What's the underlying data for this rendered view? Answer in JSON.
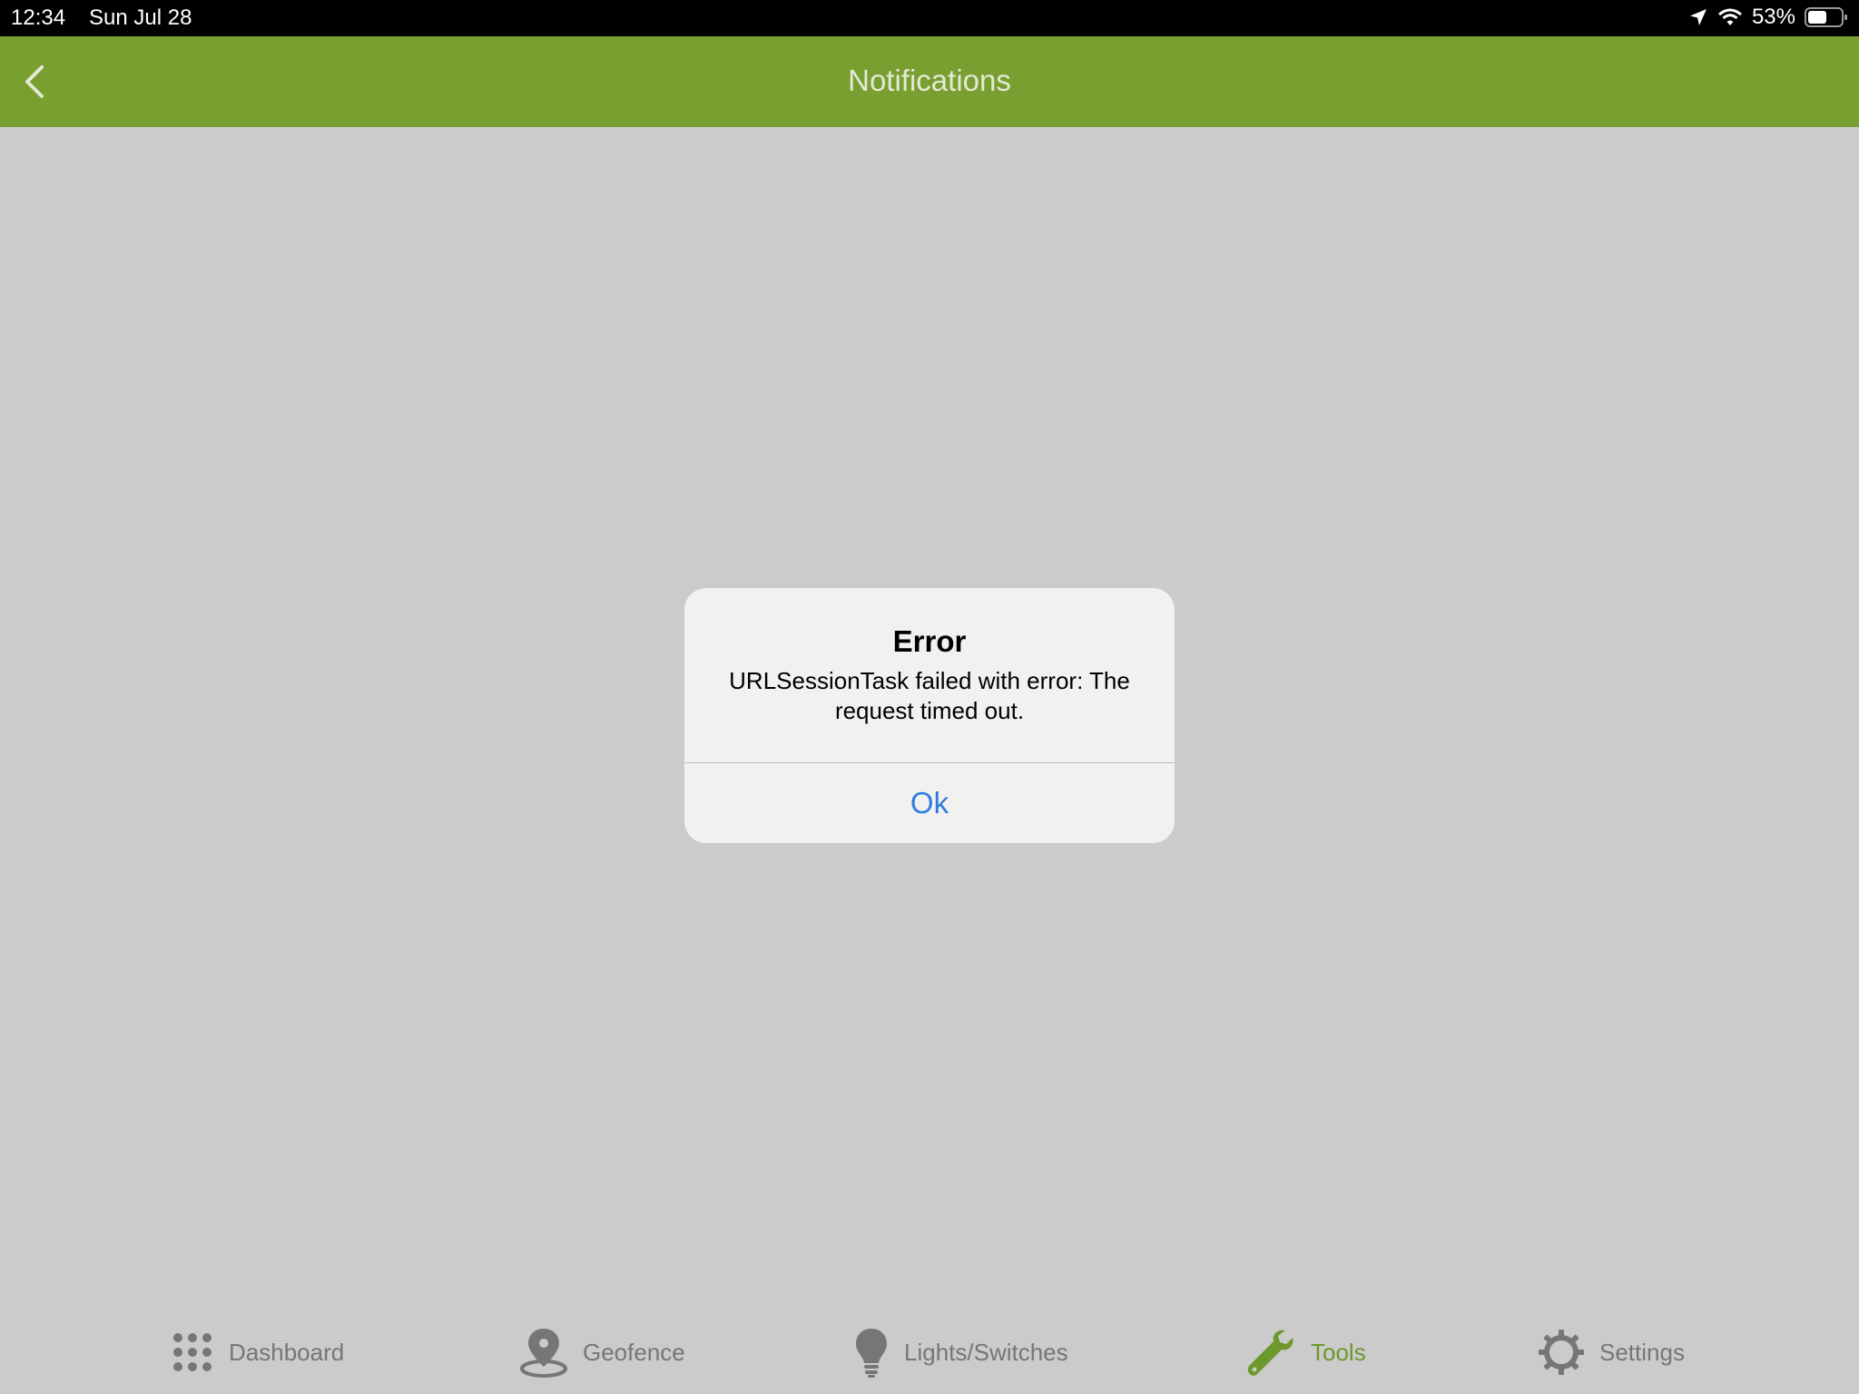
{
  "status": {
    "time": "12:34",
    "date": "Sun Jul 28",
    "battery": "53%",
    "battery_level": 0.53
  },
  "nav": {
    "title": "Notifications",
    "back_icon": "chevron-left-icon"
  },
  "alert": {
    "title": "Error",
    "message": "URLSessionTask failed with error: The request timed out.",
    "ok_label": "Ok"
  },
  "tabs": [
    {
      "label": "Dashboard",
      "icon": "grid-icon",
      "active": false
    },
    {
      "label": "Geofence",
      "icon": "map-pin-icon",
      "active": false
    },
    {
      "label": "Lights/Switches",
      "icon": "lightbulb-icon",
      "active": false
    },
    {
      "label": "Tools",
      "icon": "wrench-icon",
      "active": true
    },
    {
      "label": "Settings",
      "icon": "gear-icon",
      "active": false
    }
  ],
  "colors": {
    "nav_bg": "#799f30",
    "active_tab": "#6d982b",
    "inactive_tab": "#767676",
    "link_blue": "#2f7bdc"
  }
}
